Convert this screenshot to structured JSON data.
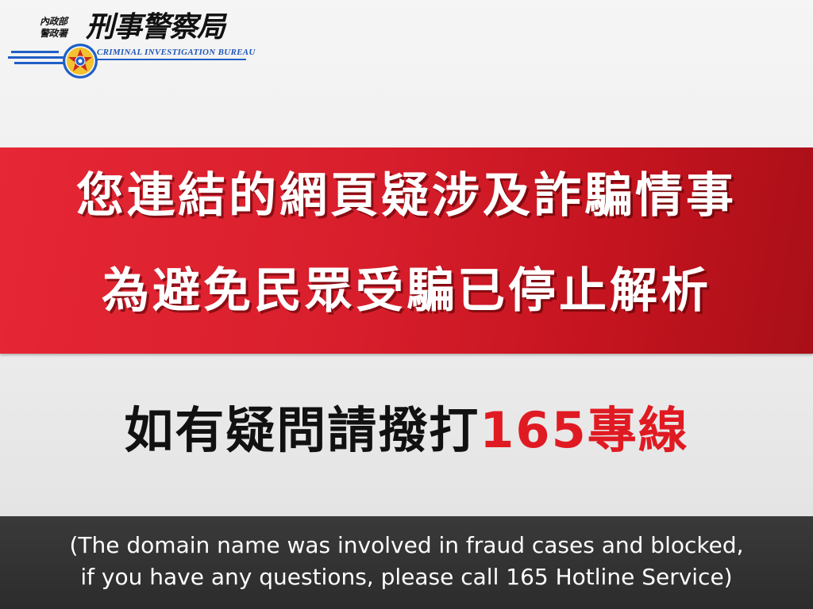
{
  "logo": {
    "agency_small_line1": "內政部",
    "agency_small_line2": "警政署",
    "agency_main": "刑事警察局",
    "agency_en": "CRIMINAL INVESTIGATION BUREAU",
    "badge_icon": "police-badge-icon",
    "stripe_color": "#1f5fc7"
  },
  "banner": {
    "line1": "您連結的網頁疑涉及詐騙情事",
    "line2": "為避免民眾受騙已停止解析",
    "color": "#d81e2c"
  },
  "hotline": {
    "prefix": "如有疑問請撥打",
    "number": "165專線",
    "number_color": "#e01a22"
  },
  "footer": {
    "line1": "(The domain name was involved in fraud cases and blocked,",
    "line2": "if you have any questions, please call 165 Hotline Service)"
  }
}
